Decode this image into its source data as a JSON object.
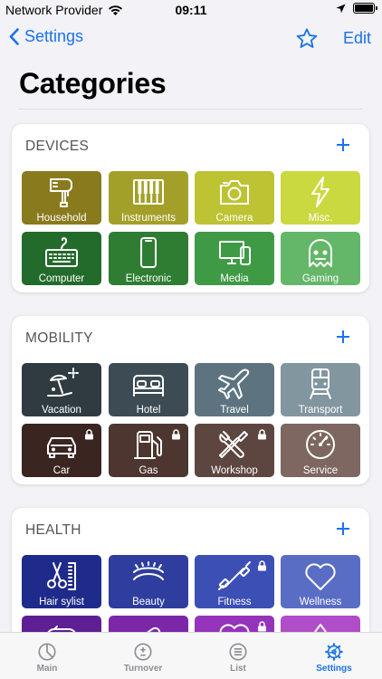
{
  "status_bar": {
    "carrier": "Network Provider",
    "time": "09:11"
  },
  "nav": {
    "back_label": "Settings",
    "edit_label": "Edit"
  },
  "page": {
    "title": "Categories"
  },
  "sections": [
    {
      "header": "DEVICES",
      "tiles": [
        {
          "label": "Household",
          "icon": "mixer-icon",
          "color": "#8a7a1e",
          "locked": false
        },
        {
          "label": "Instruments",
          "icon": "piano-icon",
          "color": "#a3a029",
          "locked": false
        },
        {
          "label": "Camera",
          "icon": "camera-icon",
          "color": "#bdc332",
          "locked": false
        },
        {
          "label": "Misc.",
          "icon": "lightning-icon",
          "color": "#cbd941",
          "locked": false
        },
        {
          "label": "Computer",
          "icon": "keyboard-icon",
          "color": "#236b2a",
          "locked": false
        },
        {
          "label": "Electronic",
          "icon": "phone-icon",
          "color": "#2e7d32",
          "locked": false
        },
        {
          "label": "Media",
          "icon": "monitor-icon",
          "color": "#3f9a46",
          "locked": false
        },
        {
          "label": "Gaming",
          "icon": "ghost-icon",
          "color": "#64b768",
          "locked": false
        }
      ]
    },
    {
      "header": "MOBILITY",
      "tiles": [
        {
          "label": "Vacation",
          "icon": "beach-umbrella-icon",
          "color": "#2f3b40",
          "locked": false
        },
        {
          "label": "Hotel",
          "icon": "bed-icon",
          "color": "#3d4c54",
          "locked": false
        },
        {
          "label": "Travel",
          "icon": "airplane-icon",
          "color": "#5d7480",
          "locked": false
        },
        {
          "label": "Transport",
          "icon": "train-icon",
          "color": "#8296a0",
          "locked": false
        },
        {
          "label": "Car",
          "icon": "car-icon",
          "color": "#3b2520",
          "locked": true
        },
        {
          "label": "Gas",
          "icon": "gas-pump-icon",
          "color": "#4d3530",
          "locked": true
        },
        {
          "label": "Workshop",
          "icon": "tools-icon",
          "color": "#5e4640",
          "locked": true
        },
        {
          "label": "Service",
          "icon": "gauge-icon",
          "color": "#7d6760",
          "locked": false
        }
      ]
    },
    {
      "header": "HEALTH",
      "tiles": [
        {
          "label": "Hair sylist",
          "icon": "scissors-comb-icon",
          "color": "#1f2b8a",
          "locked": false
        },
        {
          "label": "Beauty",
          "icon": "eye-icon",
          "color": "#2e3d9e",
          "locked": false
        },
        {
          "label": "Fitness",
          "icon": "dumbbell-icon",
          "color": "#3b4fb5",
          "locked": true
        },
        {
          "label": "Wellness",
          "icon": "heart-icon",
          "color": "#5a6dc4",
          "locked": false
        },
        {
          "label": "",
          "icon": "pill-icon",
          "color": "#5e1f94",
          "locked": false
        },
        {
          "label": "",
          "icon": "bandage-icon",
          "color": "#7b27a8",
          "locked": false
        },
        {
          "label": "",
          "icon": "heart-icon",
          "color": "#9533bb",
          "locked": true
        },
        {
          "label": "",
          "icon": "drop-icon",
          "color": "#b04ec9",
          "locked": false
        }
      ]
    }
  ],
  "tabs": [
    {
      "label": "Main",
      "icon": "pie-chart-icon",
      "active": false
    },
    {
      "label": "Turnover",
      "icon": "plus-minus-icon",
      "active": false
    },
    {
      "label": "List",
      "icon": "list-icon",
      "active": false
    },
    {
      "label": "Settings",
      "icon": "gear-icon",
      "active": true
    }
  ]
}
